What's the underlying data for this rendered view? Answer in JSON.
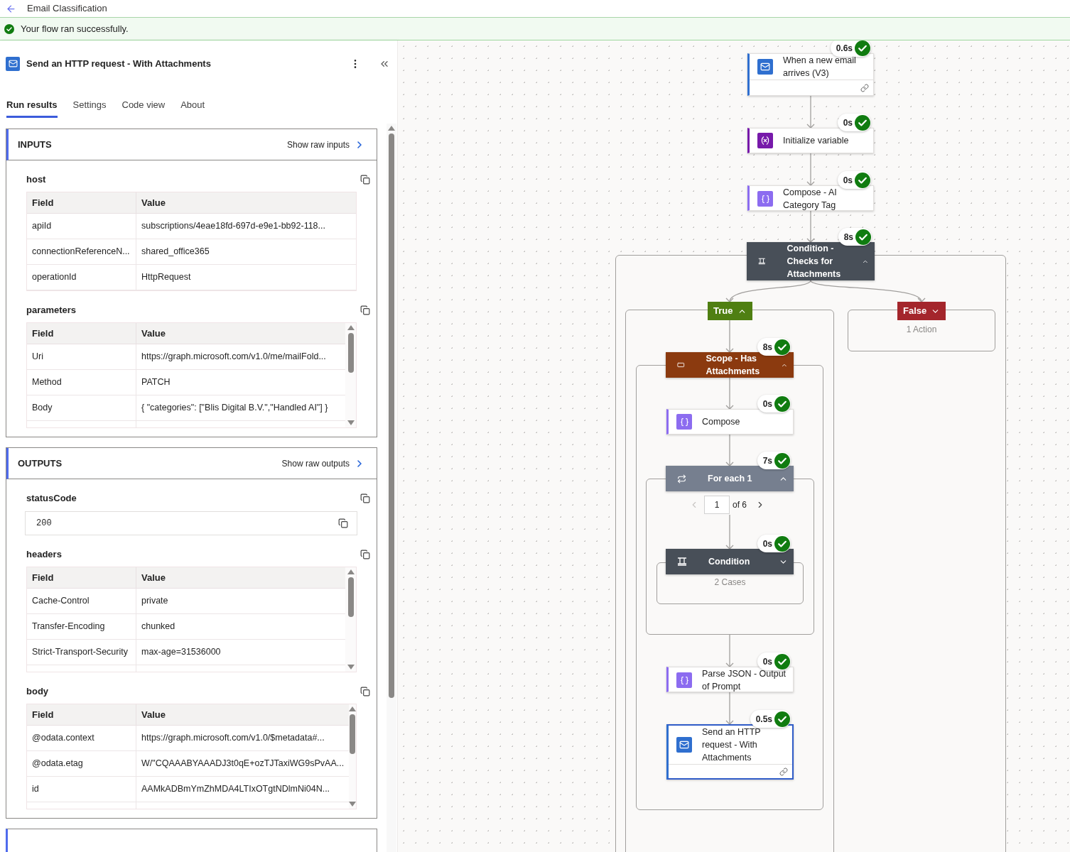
{
  "header": {
    "title": "Email Classification"
  },
  "banner": {
    "message": "Your flow ran successfully."
  },
  "panel": {
    "title": "Send an HTTP request - With Attachments",
    "tabs": [
      {
        "label": "Run results",
        "selected": true
      },
      {
        "label": "Settings",
        "selected": false
      },
      {
        "label": "Code view",
        "selected": false
      },
      {
        "label": "About",
        "selected": false
      }
    ],
    "cards": [
      {
        "heading": "INPUTS",
        "raw_link": "Show raw inputs",
        "sections": [
          {
            "name": "host",
            "kind": "table",
            "scrollable": false,
            "columns": [
              "Field",
              "Value"
            ],
            "rows": [
              [
                "apiId",
                "subscriptions/4eae18fd-697d-e9e1-bb92-118..."
              ],
              [
                "connectionReferenceN...",
                "shared_office365"
              ],
              [
                "operationId",
                "HttpRequest"
              ]
            ]
          },
          {
            "name": "parameters",
            "kind": "table",
            "scrollable": true,
            "columns": [
              "Field",
              "Value"
            ],
            "rows": [
              [
                "Uri",
                "https://graph.microsoft.com/v1.0/me/mailFold..."
              ],
              [
                "Method",
                "PATCH"
              ],
              [
                "Body",
                "{ \"categories\": [\"Blis Digital B.V.\",\"Handled AI\"] }"
              ]
            ]
          }
        ]
      },
      {
        "heading": "OUTPUTS",
        "raw_link": "Show raw outputs",
        "sections": [
          {
            "name": "statusCode",
            "kind": "code",
            "value": "200"
          },
          {
            "name": "headers",
            "kind": "table",
            "scrollable": true,
            "columns": [
              "Field",
              "Value"
            ],
            "rows": [
              [
                "Cache-Control",
                "private"
              ],
              [
                "Transfer-Encoding",
                "chunked"
              ],
              [
                "Strict-Transport-Security",
                "max-age=31536000"
              ]
            ]
          },
          {
            "name": "body",
            "kind": "table",
            "scrollable": true,
            "columns": [
              "Field",
              "Value"
            ],
            "rows": [
              [
                "@odata.context",
                "https://graph.microsoft.com/v1.0/$metadata#..."
              ],
              [
                "@odata.etag",
                "W/\"CQAAABYAAADJ3t0qE+ozTJTaxiWG9sPvAA..."
              ],
              [
                "id",
                "AAMkADBmYmZhMDA4LTIxOTgtNDlmNi04N..."
              ]
            ]
          }
        ]
      }
    ]
  },
  "canvas": {
    "nodes": [
      {
        "kind": "trigger",
        "title": "When a new email arrives (V3)",
        "duration": "0.6s",
        "selected": false
      },
      {
        "kind": "variable",
        "title": "Initialize variable",
        "duration": "0s",
        "selected": false
      },
      {
        "kind": "compose",
        "title": "Compose - AI Category Tag",
        "duration": "0s",
        "selected": false
      },
      {
        "kind": "condition",
        "title": "Condition - Checks for Attachments",
        "duration": "8s",
        "expanded": true
      },
      {
        "kind": "branch",
        "label": "True",
        "color": "#4f7f12",
        "expanded": true
      },
      {
        "kind": "branch",
        "label": "False",
        "color": "#a4262c",
        "expanded": false,
        "summary": "1 Action"
      },
      {
        "kind": "scope",
        "title": "Scope - Has Attachments",
        "duration": "8s",
        "expanded": true
      },
      {
        "kind": "compose",
        "title": "Compose",
        "duration": "0s",
        "selected": false
      },
      {
        "kind": "foreach",
        "title": "For each 1",
        "duration": "7s",
        "expanded": true,
        "pager": {
          "current": "1",
          "total": "of 6"
        }
      },
      {
        "kind": "condition",
        "title": "Condition",
        "duration": "0s",
        "expanded": false,
        "summary": "2 Cases"
      },
      {
        "kind": "parse",
        "title": "Parse JSON - Output of Prompt",
        "duration": "0s",
        "selected": false
      },
      {
        "kind": "http",
        "title": "Send an HTTP request - With Attachments",
        "duration": "0.5s",
        "selected": true
      }
    ]
  }
}
